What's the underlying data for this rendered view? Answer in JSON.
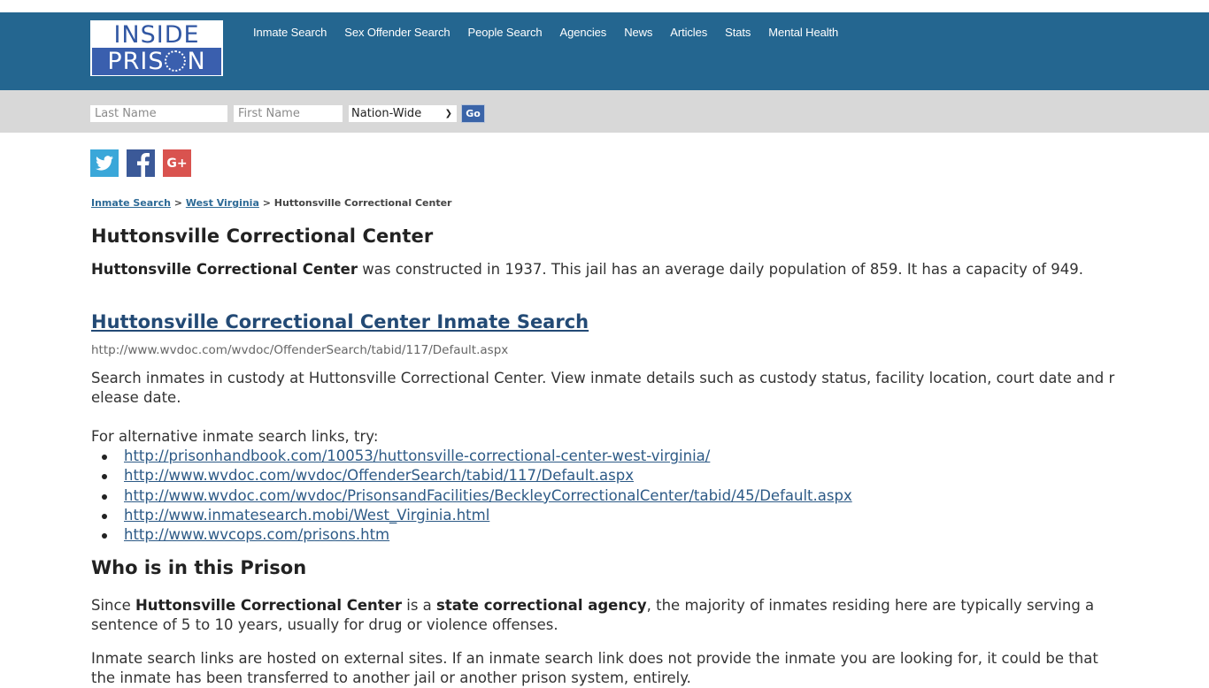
{
  "header": {
    "logo_top": "INSIDE",
    "logo_bottom_pre": "PRIS",
    "logo_bottom_post": "N",
    "nav": [
      {
        "label": "Inmate Search"
      },
      {
        "label": "Sex Offender Search"
      },
      {
        "label": "People Search"
      },
      {
        "label": "Agencies"
      },
      {
        "label": "News"
      },
      {
        "label": "Articles"
      },
      {
        "label": "Stats"
      },
      {
        "label": "Mental Health"
      }
    ],
    "colors": {
      "header_bg": "#246690",
      "search_bg": "#d8d8d8"
    }
  },
  "search": {
    "last_name_placeholder": "Last Name",
    "first_name_placeholder": "First Name",
    "last_name_value": "",
    "first_name_value": "",
    "region_selected": "Nation-Wide",
    "go_label": "Go"
  },
  "social": [
    {
      "name": "twitter",
      "color": "#3aa7d9"
    },
    {
      "name": "facebook",
      "color": "#3b5998"
    },
    {
      "name": "google-plus",
      "label": "G+",
      "color": "#d9534f"
    }
  ],
  "breadcrumb": {
    "items": [
      "Inmate Search",
      "West Virginia"
    ],
    "separator": ">",
    "current": "Huttonsville Correctional Center"
  },
  "main": {
    "title": "Huttonsville Correctional Center",
    "intro_bold": "Huttonsville Correctional Center",
    "intro_text": " was constructed in 1937. This jail has an average daily population of 859. It has a capacity of 949.",
    "inmate_search_title": "Huttonsville Correctional Center Inmate Search",
    "inmate_search_url": "http://www.wvdoc.com/wvdoc/OffenderSearch/tabid/117/Default.aspx",
    "inmate_search_desc": "Search inmates in custody at Huttonsville Correctional Center. View inmate details such as custody status, facility location, court date and release date.",
    "alt_label": "For alternative inmate search links, try:",
    "alt_links": [
      "http://prisonhandbook.com/10053/huttonsville-correctional-center-west-virginia/",
      "http://www.wvdoc.com/wvdoc/OffenderSearch/tabid/117/Default.aspx",
      "http://www.wvdoc.com/wvdoc/PrisonsandFacilities/BeckleyCorrectionalCenter/tabid/45/Default.aspx",
      "http://www.inmatesearch.mobi/West_Virginia.html",
      "http://www.wvcops.com/prisons.htm"
    ],
    "who_title": "Who is in this Prison",
    "who_p1": "Since ",
    "who_b1": "Huttonsville Correctional Center",
    "who_p2": " is a ",
    "who_b2": "state correctional agency",
    "who_p3": ", the majority of inmates residing here are typically serving a sentence of 5 to 10 years, usually for drug or violence offenses.",
    "external_note": "Inmate search links are hosted on external sites. If an inmate search link does not provide the inmate you are looking for, it could be that the inmate has been transferred to another jail or another prison system, entirely."
  }
}
